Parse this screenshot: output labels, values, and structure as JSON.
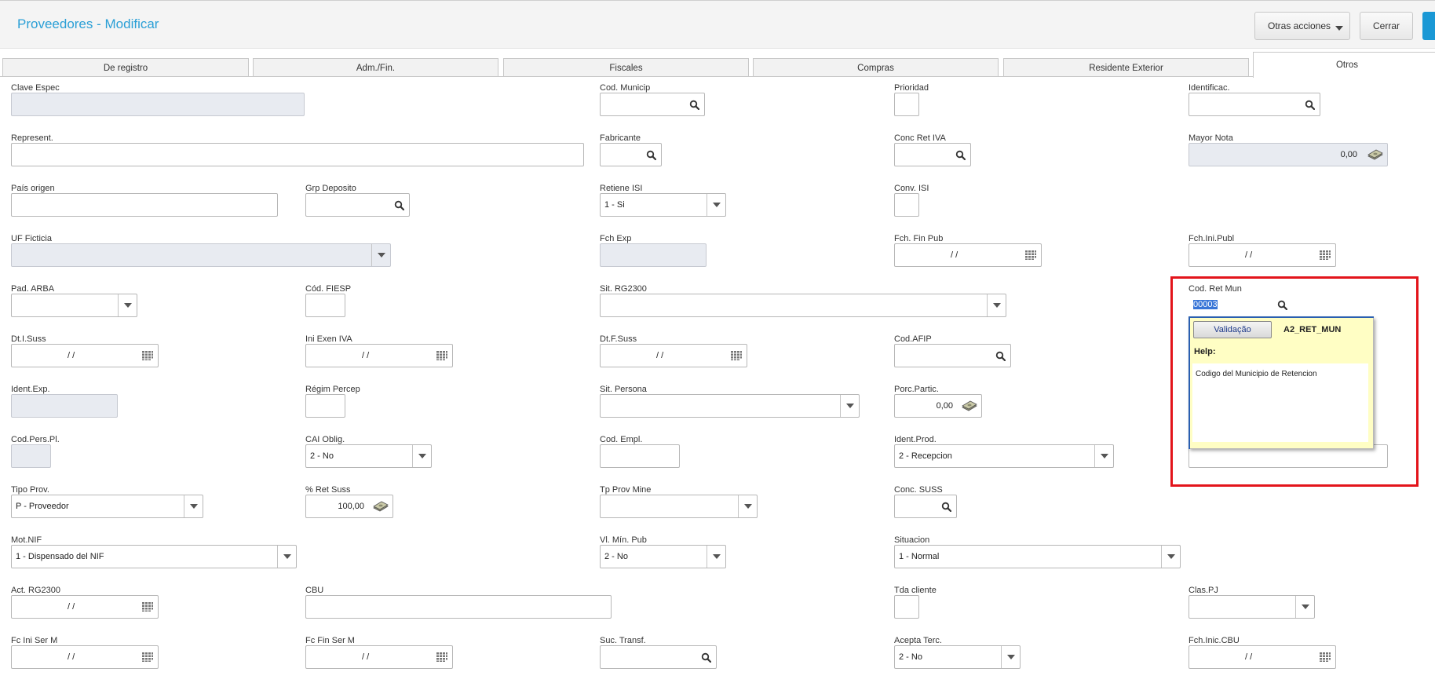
{
  "header": {
    "title": "Proveedores - Modificar",
    "actions_label": "Otras acciones",
    "close_label": "Cerrar"
  },
  "tabs": [
    {
      "label": "De registro",
      "active": false
    },
    {
      "label": "Adm./Fin.",
      "active": false
    },
    {
      "label": "Fiscales",
      "active": false
    },
    {
      "label": "Compras",
      "active": false
    },
    {
      "label": "Residente Exterior",
      "active": false
    },
    {
      "label": "Otros",
      "active": true
    }
  ],
  "fields": {
    "clave_espec": {
      "label": "Clave Espec",
      "value": ""
    },
    "cod_municip": {
      "label": "Cod. Municip",
      "value": ""
    },
    "prioridad": {
      "label": "Prioridad",
      "value": ""
    },
    "identificac": {
      "label": "Identificac.",
      "value": ""
    },
    "represent": {
      "label": "Represent.",
      "value": ""
    },
    "fabricante": {
      "label": "Fabricante",
      "value": ""
    },
    "conc_ret_iva": {
      "label": "Conc Ret IVA",
      "value": ""
    },
    "mayor_nota": {
      "label": "Mayor Nota",
      "value": "0,00"
    },
    "pais_origen": {
      "label": "País origen",
      "value": ""
    },
    "grp_deposito": {
      "label": "Grp Deposito",
      "value": ""
    },
    "retiene_isi": {
      "label": "Retiene ISI",
      "value": "1 - Si"
    },
    "conv_isi": {
      "label": "Conv. ISI",
      "value": ""
    },
    "uf_ficticia": {
      "label": "UF Ficticia",
      "value": ""
    },
    "fch_exp": {
      "label": "Fch Exp",
      "value": ""
    },
    "fch_fin_pub": {
      "label": "Fch. Fin Pub",
      "value": " / /"
    },
    "fch_ini_publ": {
      "label": "Fch.Ini.Publ",
      "value": " / /"
    },
    "pad_arba": {
      "label": "Pad. ARBA",
      "value": ""
    },
    "cod_fiesp": {
      "label": "Cód. FIESP",
      "value": ""
    },
    "sit_rg2300": {
      "label": "Sit. RG2300",
      "value": ""
    },
    "cod_ret_mun": {
      "label": "Cod. Ret Mun",
      "value": "00003"
    },
    "dt_i_suss": {
      "label": "Dt.I.Suss",
      "value": " / /"
    },
    "ini_exen_iva": {
      "label": "Ini Exen IVA",
      "value": " / /"
    },
    "dt_f_suss": {
      "label": "Dt.F.Suss",
      "value": " / /"
    },
    "cod_afip": {
      "label": "Cod.AFIP",
      "value": ""
    },
    "ident_exp": {
      "label": "Ident.Exp.",
      "value": ""
    },
    "regim_percep": {
      "label": "Régim Percep",
      "value": ""
    },
    "sit_persona": {
      "label": "Sit. Persona",
      "value": ""
    },
    "porc_partic": {
      "label": "Porc.Partic.",
      "value": "0,00"
    },
    "cod_pers_pl": {
      "label": "Cod.Pers.Pl.",
      "value": ""
    },
    "cai_oblig": {
      "label": "CAI Oblig.",
      "value": "2 - No"
    },
    "cod_empl": {
      "label": "Cod. Empl.",
      "value": ""
    },
    "ident_prod": {
      "label": "Ident.Prod.",
      "value": "2 - Recepcion"
    },
    "tipo_prov": {
      "label": "Tipo Prov.",
      "value": "P - Proveedor"
    },
    "ret_suss": {
      "label": "% Ret Suss",
      "value": "100,00"
    },
    "tp_prov_mine": {
      "label": "Tp Prov Mine",
      "value": ""
    },
    "conc_suss": {
      "label": "Conc. SUSS",
      "value": ""
    },
    "mot_nif": {
      "label": "Mot.NIF",
      "value": "1 - Dispensado del NIF"
    },
    "vl_min_pub": {
      "label": "Vl. Mín. Pub",
      "value": "2 - No"
    },
    "situacion": {
      "label": "Situacion",
      "value": "1 - Normal"
    },
    "act_rg2300": {
      "label": "Act. RG2300",
      "value": " / /"
    },
    "cbu": {
      "label": "CBU",
      "value": ""
    },
    "tda_cliente": {
      "label": "Tda cliente",
      "value": ""
    },
    "clas_pj": {
      "label": "Clas.PJ",
      "value": ""
    },
    "fc_ini_ser_m": {
      "label": "Fc Ini Ser M",
      "value": " / /"
    },
    "fc_fin_ser_m": {
      "label": "Fc Fin Ser M",
      "value": " / /"
    },
    "suc_transf": {
      "label": "Suc. Transf.",
      "value": ""
    },
    "acepta_terc": {
      "label": "Acepta Terc.",
      "value": "2 - No"
    },
    "fch_inic_cbu": {
      "label": "Fch.Inic.CBU",
      "value": " / /"
    }
  },
  "help_popup": {
    "validation_label": "Validação",
    "field_code": "A2_RET_MUN",
    "help_label": "Help:",
    "help_text": "Codigo del Municipio de Retencion"
  },
  "colors": {
    "title": "#2a9fd6",
    "highlight_box": "#e3141b",
    "popup_bg": "#fffec4",
    "primary_button": "#1a98d5"
  }
}
